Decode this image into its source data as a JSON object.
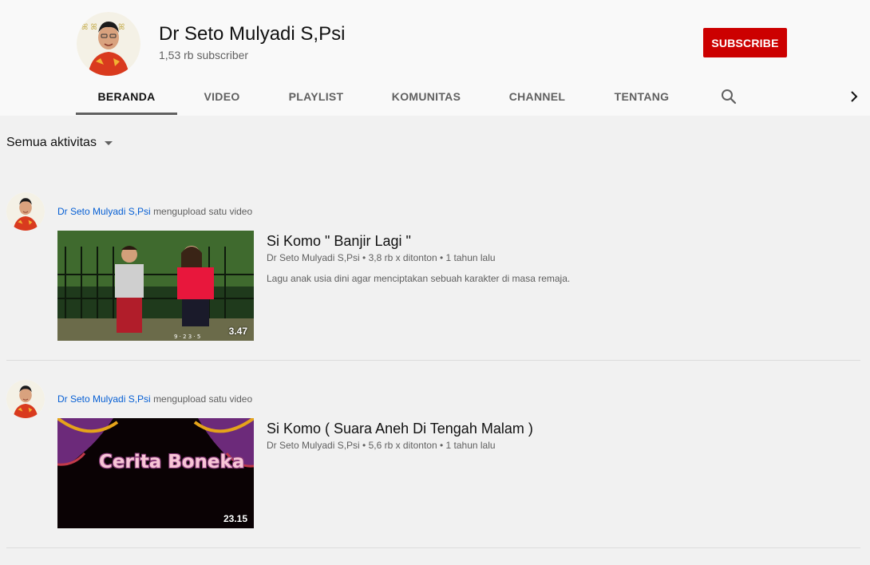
{
  "channel": {
    "name": "Dr Seto Mulyadi S,Psi",
    "subscribers": "1,53 rb subscriber",
    "subscribe_label": "SUBSCRIBE"
  },
  "tabs": [
    {
      "label": "BERANDA",
      "active": true
    },
    {
      "label": "VIDEO",
      "active": false
    },
    {
      "label": "PLAYLIST",
      "active": false
    },
    {
      "label": "KOMUNITAS",
      "active": false
    },
    {
      "label": "CHANNEL",
      "active": false
    },
    {
      "label": "TENTANG",
      "active": false
    }
  ],
  "icons": {
    "search": "search-icon",
    "next": "chevron-right-icon",
    "dropdown": "caret-down-icon"
  },
  "filter": {
    "label": "Semua aktivitas"
  },
  "activities": [
    {
      "author": "Dr Seto Mulyadi S,Psi",
      "action": "mengupload satu video",
      "video": {
        "title": "Si Komo \" Banjir Lagi \"",
        "meta": "Dr Seto Mulyadi S,Psi • 3,8 rb x ditonton • 1 tahun lalu",
        "description": "Lagu anak usia dini agar menciptakan sebuah karakter di masa remaja.",
        "duration": "3.47"
      }
    },
    {
      "author": "Dr Seto Mulyadi S,Psi",
      "action": "mengupload satu video",
      "video": {
        "title": "Si Komo ( Suara Aneh Di Tengah Malam )",
        "meta": "Dr Seto Mulyadi S,Psi • 5,6 rb x ditonton • 1 tahun lalu",
        "description": "",
        "duration": "23.15",
        "thumbnail_text": "Cerita Boneka"
      }
    }
  ],
  "colors": {
    "subscribe": "#cc0000",
    "author_link": "#065fd4",
    "background": "#f1f1f1",
    "header": "#f9f9f9"
  }
}
